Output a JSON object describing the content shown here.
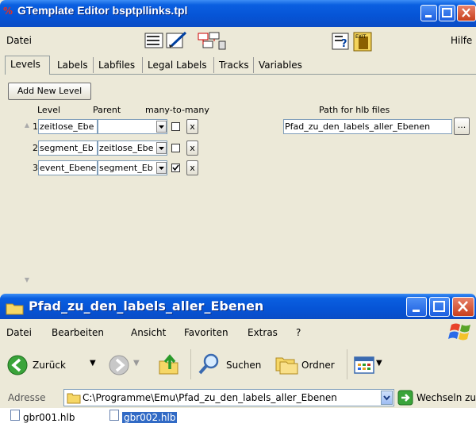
{
  "editor_window": {
    "title": "GTemplate Editor bsptpllinks.tpl",
    "menu": {
      "file": "Datei",
      "help": "Hilfe"
    },
    "tabs": [
      "Levels",
      "Labels",
      "Labfiles",
      "Legal Labels",
      "Tracks",
      "Variables"
    ],
    "active_tab": "Levels",
    "add_level_button": "Add New Level",
    "headers": {
      "level": "Level",
      "parent": "Parent",
      "many_to_many": "many-to-many",
      "path": "Path for hlb files"
    },
    "rows": [
      {
        "num": "1",
        "level": "zeitlose_Ebe",
        "parent": "",
        "many_to_many": false,
        "remove": "x"
      },
      {
        "num": "2",
        "level": "segment_Eb",
        "parent": "zeitlose_Ebe",
        "many_to_many": false,
        "remove": "x"
      },
      {
        "num": "3",
        "level": "event_Ebene",
        "parent": "segment_Eb",
        "many_to_many": true,
        "remove": "x"
      }
    ],
    "path_value": "Pfad_zu_den_labels_aller_Ebenen",
    "browse_button": "..."
  },
  "explorer_window": {
    "title": "Pfad_zu_den_labels_aller_Ebenen",
    "menu": [
      "Datei",
      "Bearbeiten",
      "Ansicht",
      "Favoriten",
      "Extras",
      "?"
    ],
    "toolbar": {
      "back": "Zurück",
      "search": "Suchen",
      "folders": "Ordner"
    },
    "address_label": "Adresse",
    "address_value": "C:\\Programme\\Emu\\Pfad_zu_den_labels_aller_Ebenen",
    "go_button": "Wechseln zu",
    "files": [
      {
        "name": "gbr001.hlb",
        "selected": false
      },
      {
        "name": "gbr002.hlb",
        "selected": true
      }
    ]
  }
}
